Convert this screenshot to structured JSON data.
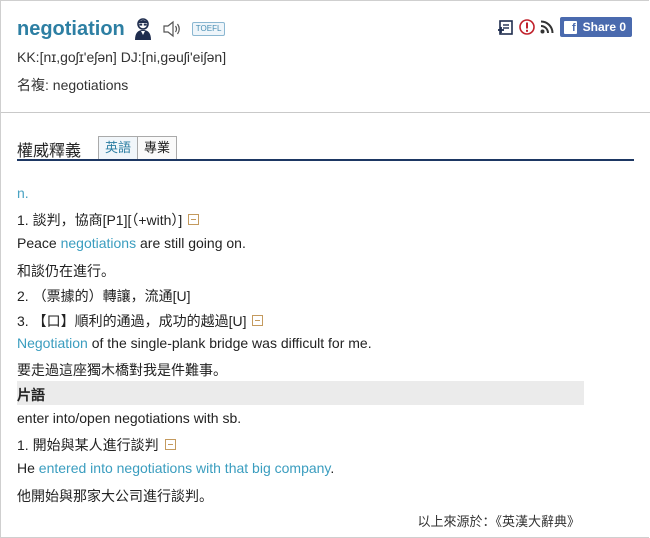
{
  "entry": {
    "word": "negotiation",
    "badge": "TOEFL",
    "pronunciation": "KK:[nɪ,goʃɪ'eʃən]  DJ:[ni,gəuʃi'eiʃən]",
    "plural": "名複: negotiations"
  },
  "toolbar": {
    "share_label": "Share 0",
    "fb_glyph": "f"
  },
  "section": {
    "title": "權威釋義",
    "tabs": [
      {
        "label": "英語"
      },
      {
        "label": "專業"
      }
    ]
  },
  "definitions": {
    "pos": "n.",
    "d1": "1. 談判，協商[P1][（+with）]",
    "ex1": {
      "pre": "Peace ",
      "hl": "negotiations",
      "post": " are still going on."
    },
    "tr1": "和談仍在進行。",
    "d2": "2. （票據的）轉讓，流通[U]",
    "d3": "3. 【口】順利的通過，成功的越過[U]",
    "ex3": {
      "hl": "Negotiation",
      "post": " of the single-plank bridge was difficult for me."
    },
    "tr3": "要走過這座獨木橋對我是件難事。"
  },
  "phrases": {
    "title": "片語",
    "phrase": "enter into/open negotiations with sb.",
    "d1": "1. 開始與某人進行談判",
    "ex1": {
      "pre": "He ",
      "hl": "entered into negotiations with that big company",
      "post": "."
    },
    "tr1": "他開始與那家大公司進行談判。"
  },
  "source": "以上來源於：《英漢大辭典》",
  "colors": {
    "accent": "#2d7fa3",
    "link": "#3a9dbf",
    "rule": "#1d3763",
    "share": "#4a6aae"
  }
}
